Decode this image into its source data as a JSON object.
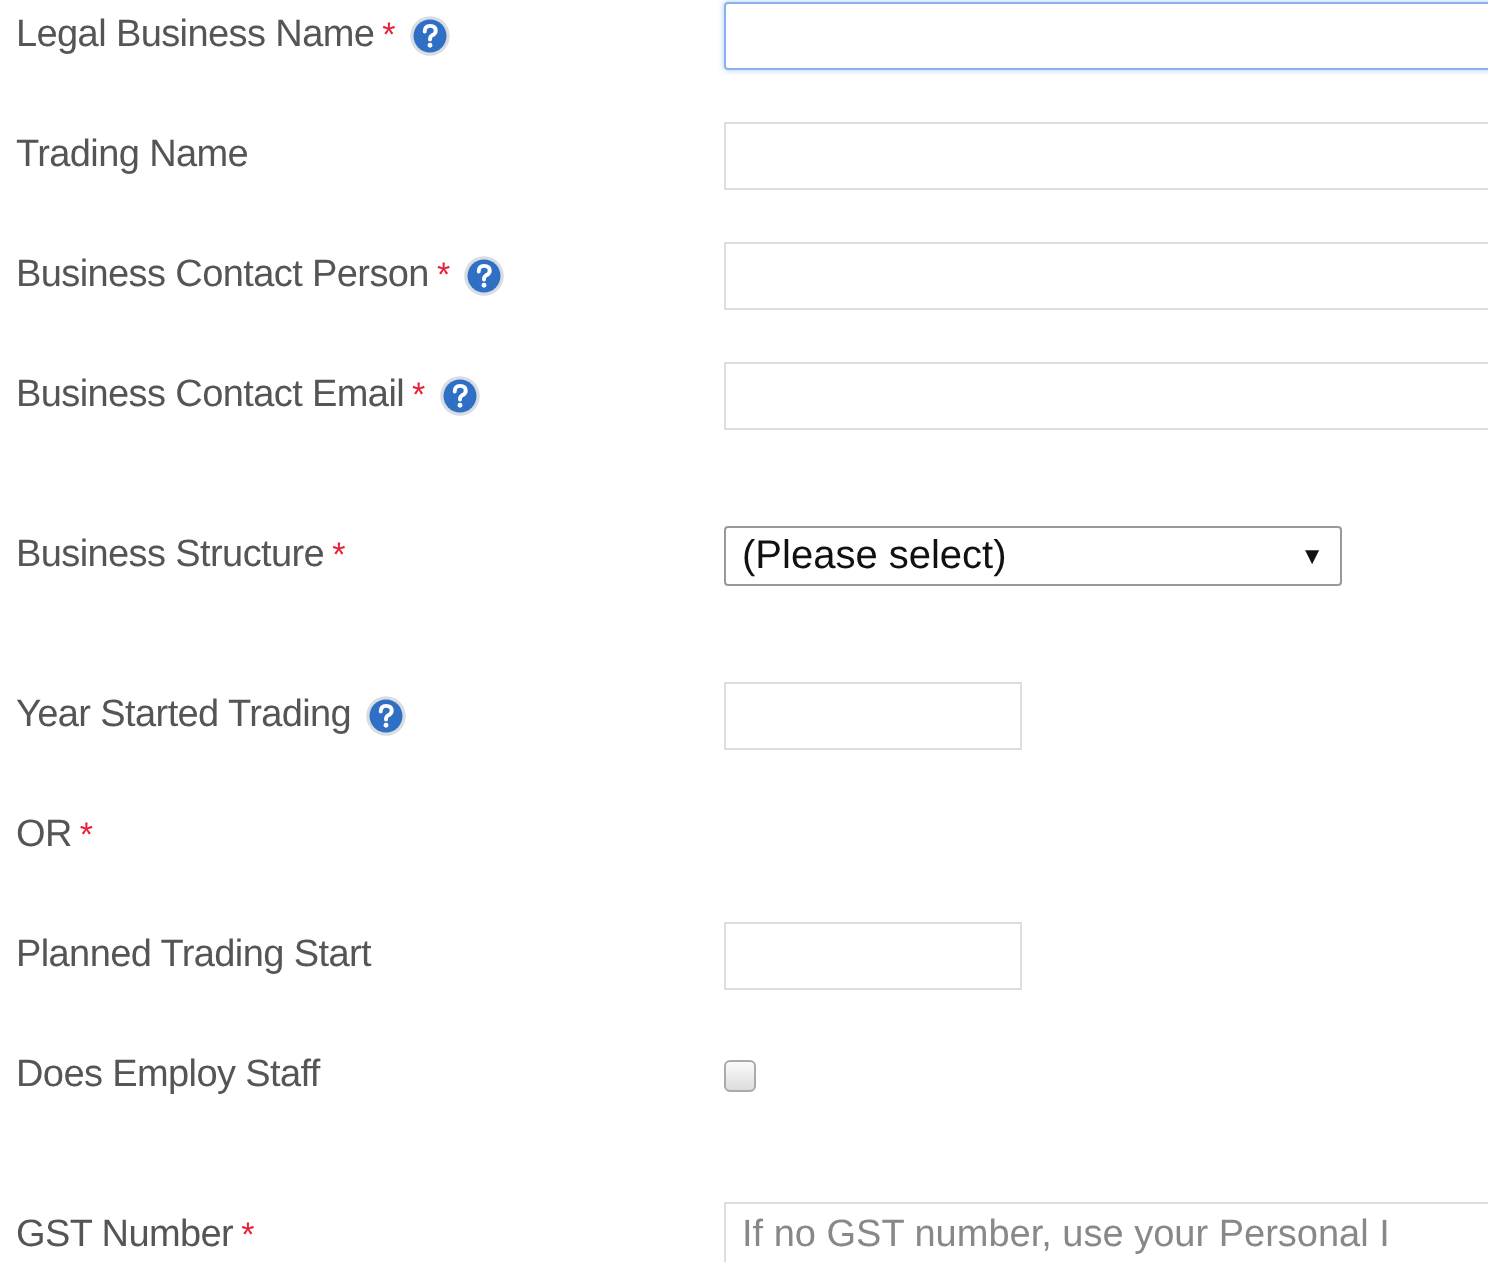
{
  "fields": [
    {
      "label": "Legal Business Name",
      "required": true,
      "help": true,
      "kind": "text",
      "focused": true
    },
    {
      "label": "Trading Name",
      "required": false,
      "help": false,
      "kind": "text",
      "focused": false
    },
    {
      "label": "Business Contact Person",
      "required": true,
      "help": true,
      "kind": "text",
      "focused": false
    },
    {
      "label": "Business Contact Email",
      "required": true,
      "help": true,
      "kind": "text",
      "focused": false
    },
    {
      "label": "Business Structure",
      "required": true,
      "help": false,
      "kind": "select",
      "value": "(Please select)",
      "arrow": "▼"
    },
    {
      "label": "Year Started Trading",
      "required": false,
      "help": true,
      "kind": "short",
      "focused": false
    },
    {
      "label": "OR",
      "required": true,
      "help": false,
      "kind": "note"
    },
    {
      "label": "Planned Trading Start",
      "required": false,
      "help": false,
      "kind": "short",
      "focused": false
    },
    {
      "label": "Does Employ Staff",
      "required": false,
      "help": false,
      "kind": "checkbox",
      "checked": false
    },
    {
      "label": "GST Number",
      "required": true,
      "help": false,
      "kind": "text",
      "focused": false,
      "placeholder": "If no GST number, use your Personal I"
    }
  ],
  "required_mark": "*"
}
